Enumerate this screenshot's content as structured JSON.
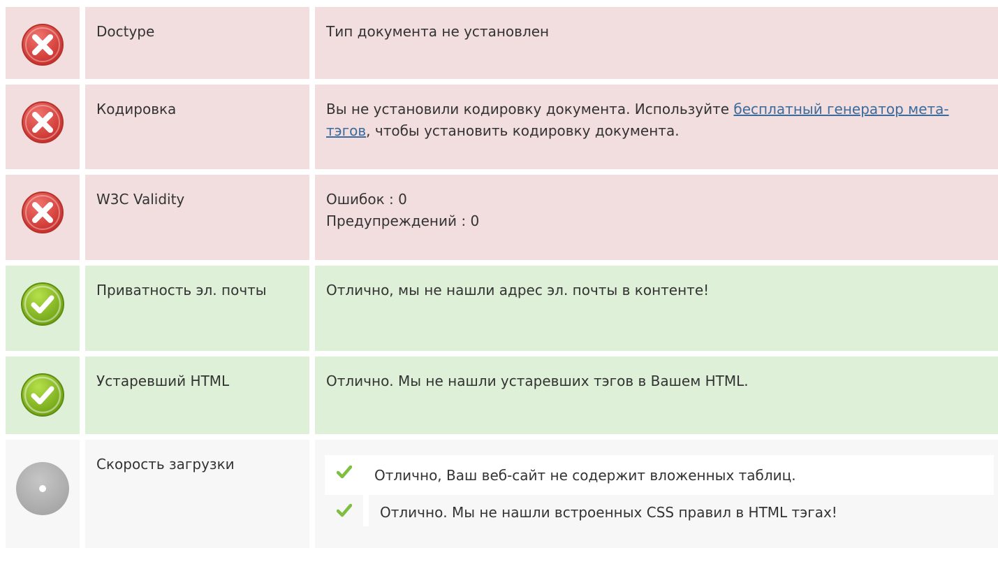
{
  "rows": [
    {
      "status": "error",
      "icon": "error-x-icon",
      "label": "Doctype",
      "text": "Тип документа не установлен"
    },
    {
      "status": "error",
      "icon": "error-x-icon",
      "label": "Кодировка",
      "text_before": "Вы не установили кодировку документа. Используйте ",
      "link_text": "бесплатный генератор мета-тэгов",
      "text_after": ", чтобы установить кодировку документа."
    },
    {
      "status": "error",
      "icon": "error-x-icon",
      "label": "W3C Validity",
      "lines": [
        "Ошибок : 0",
        "Предупреждений : 0"
      ]
    },
    {
      "status": "ok",
      "icon": "check-circle-icon",
      "label": "Приватность эл. почты",
      "text": "Отлично, мы не нашли адрес эл. почты в контенте!"
    },
    {
      "status": "ok",
      "icon": "check-circle-icon",
      "label": "Устаревший HTML",
      "text": "Отлично. Мы не нашли устаревших тэгов в Вашем HTML."
    },
    {
      "status": "neutral",
      "icon": "neutral-circle-icon",
      "label": "Скорость загрузки",
      "items": [
        {
          "icon": "small-check-icon",
          "text": "Отлично, Ваш веб-сайт не содержит вложенных таблиц."
        },
        {
          "icon": "small-check-icon",
          "text": "Отлично. Мы не нашли встроенных CSS правил в HTML тэгах!"
        }
      ]
    }
  ],
  "colors": {
    "error_bg": "#f2dede",
    "ok_bg": "#dff0d8",
    "neutral_bg": "#f7f7f7",
    "error_icon": "#d9403a",
    "ok_icon": "#8ac11e",
    "neutral_icon": "#b3b3b3",
    "link": "#3a6b9c",
    "small_check": "#7fbf3f"
  }
}
